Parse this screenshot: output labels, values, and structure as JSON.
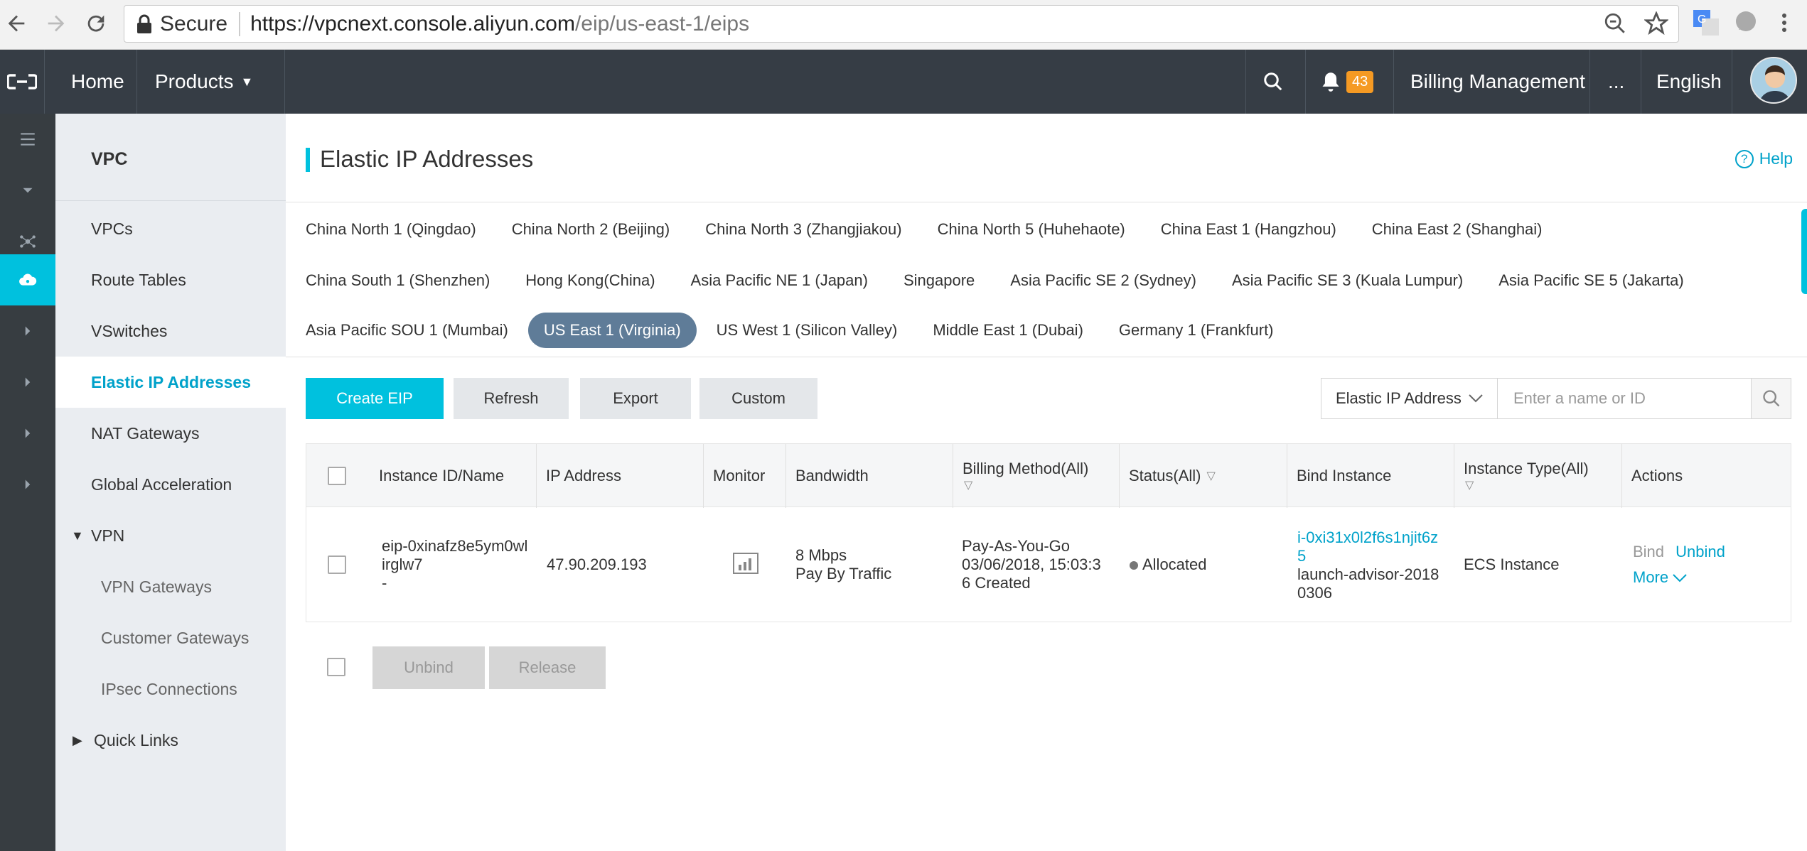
{
  "browser": {
    "secure_label": "Secure",
    "url_host": "https://vpcnext.console.aliyun.com",
    "url_path": "/eip/us-east-1/eips"
  },
  "topnav": {
    "home": "Home",
    "products": "Products",
    "notification_count": "43",
    "billing": "Billing Management",
    "more": "...",
    "language": "English"
  },
  "sidebar": {
    "title": "VPC",
    "items": [
      {
        "label": "VPCs"
      },
      {
        "label": "Route Tables"
      },
      {
        "label": "VSwitches"
      },
      {
        "label": "Elastic IP Addresses"
      },
      {
        "label": "NAT Gateways"
      },
      {
        "label": "Global Acceleration"
      },
      {
        "label": "VPN"
      },
      {
        "label": "VPN Gateways"
      },
      {
        "label": "Customer Gateways"
      },
      {
        "label": "IPsec Connections"
      },
      {
        "label": "Quick Links"
      }
    ]
  },
  "page": {
    "title": "Elastic IP Addresses",
    "help": "Help"
  },
  "regions": {
    "row1": [
      "China North 1 (Qingdao)",
      "China North 2 (Beijing)",
      "China North 3 (Zhangjiakou)",
      "China North 5 (Huhehaote)",
      "China East 1 (Hangzhou)",
      "China East 2 (Shanghai)"
    ],
    "row2": [
      "China South 1 (Shenzhen)",
      "Hong Kong(China)",
      "Asia Pacific NE 1 (Japan)",
      "Singapore",
      "Asia Pacific SE 2 (Sydney)",
      "Asia Pacific SE 3 (Kuala Lumpur)",
      "Asia Pacific SE 5 (Jakarta)"
    ],
    "row3": [
      "Asia Pacific SOU 1 (Mumbai)",
      "US East 1 (Virginia)",
      "US West 1 (Silicon Valley)",
      "Middle East 1 (Dubai)",
      "Germany 1 (Frankfurt)"
    ],
    "selected": "US East 1 (Virginia)"
  },
  "toolbar": {
    "create": "Create EIP",
    "refresh": "Refresh",
    "export": "Export",
    "custom": "Custom",
    "filter_select": "Elastic IP Address",
    "search_placeholder": "Enter a name or ID"
  },
  "table": {
    "columns": [
      "Instance ID/Name",
      "IP Address",
      "Monitor",
      "Bandwidth",
      "Billing Method(All)",
      "Status(All)",
      "Bind Instance",
      "Instance Type(All)",
      "Actions"
    ],
    "rows": [
      {
        "id_line1": "eip-0xinafz8e5ym0wl",
        "id_line2": "irglw7",
        "name": "-",
        "ip": "47.90.209.193",
        "bandwidth": "8 Mbps",
        "bandwidth_type": "Pay By Traffic",
        "billing_line1": "Pay-As-You-Go",
        "billing_line2": "03/06/2018, 15:03:3",
        "billing_line3": "6 Created",
        "status": "Allocated",
        "bind_id_line1": "i-0xi31x0l2f6s1njit6z",
        "bind_id_line2": "5",
        "bind_name_line1": "launch-advisor-2018",
        "bind_name_line2": "0306",
        "instance_type": "ECS Instance",
        "action_bind": "Bind",
        "action_unbind": "Unbind",
        "action_more": "More"
      }
    ]
  },
  "footer": {
    "unbind": "Unbind",
    "release": "Release"
  },
  "colors": {
    "accent": "#00c1de",
    "topnav_bg": "#363d45",
    "sidebar_bg": "#eaedf1",
    "selected_region": "#5f7c98"
  }
}
